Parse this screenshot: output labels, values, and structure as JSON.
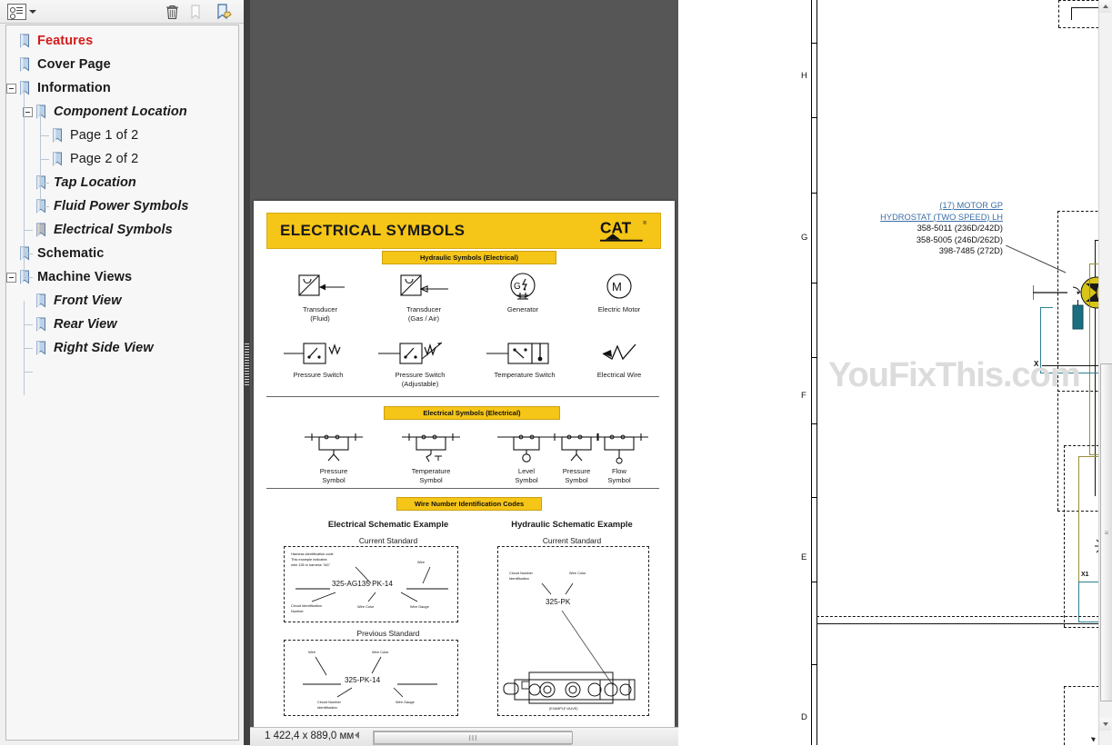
{
  "bookmark_panel": {
    "toolbar": {
      "options_icon": "bookmark-options-icon",
      "delete_icon": "trash-icon",
      "new_icon": "new-bookmark-icon",
      "edit_icon": "edit-bookmark-icon"
    },
    "items": [
      {
        "label": "Features",
        "level": 0,
        "style": "highlight",
        "expander": "none"
      },
      {
        "label": "Cover Page",
        "level": 0,
        "style": "bold",
        "expander": "none"
      },
      {
        "label": "Information",
        "level": 0,
        "style": "bold",
        "expander": "minus"
      },
      {
        "label": "Component Location",
        "level": 1,
        "style": "bold-italic",
        "expander": "minus"
      },
      {
        "label": "Page 1 of 2",
        "level": 2,
        "style": "normal",
        "expander": "none"
      },
      {
        "label": "Page 2 of 2",
        "level": 2,
        "style": "normal",
        "expander": "none"
      },
      {
        "label": "Tap Location",
        "level": 1,
        "style": "bold-italic",
        "expander": "none"
      },
      {
        "label": "Fluid Power Symbols",
        "level": 1,
        "style": "bold-italic",
        "expander": "none"
      },
      {
        "label": "Electrical Symbols",
        "level": 1,
        "style": "bold-italic",
        "expander": "none"
      },
      {
        "label": "Schematic",
        "level": 0,
        "style": "bold",
        "expander": "none"
      },
      {
        "label": "Machine Views",
        "level": 0,
        "style": "bold",
        "expander": "minus"
      },
      {
        "label": "Front View",
        "level": 1,
        "style": "normal",
        "expander": "none"
      },
      {
        "label": "Rear View",
        "level": 1,
        "style": "normal",
        "expander": "none"
      },
      {
        "label": "Right Side View",
        "level": 1,
        "style": "normal",
        "expander": "none"
      }
    ]
  },
  "document_page": {
    "title": "ELECTRICAL SYMBOLS",
    "brand": "CAT",
    "brand_tm": "®",
    "sections": [
      {
        "band": "Hydraulic Symbols (Electrical)"
      },
      {
        "band": "Electrical Symbols (Electrical)"
      },
      {
        "band": "Wire Number Identification Codes"
      }
    ],
    "hydraulic_symbols_row1": [
      {
        "name": "transducer-fluid-symbol",
        "caption_line1": "Transducer",
        "caption_line2": "(Fluid)"
      },
      {
        "name": "transducer-gas-air-symbol",
        "caption_line1": "Transducer",
        "caption_line2": "(Gas / Air)"
      },
      {
        "name": "generator-symbol",
        "caption_line1": "Generator",
        "caption_line2": ""
      },
      {
        "name": "electric-motor-symbol",
        "caption_line1": "Electric Motor",
        "caption_line2": ""
      }
    ],
    "hydraulic_symbols_row2": [
      {
        "name": "pressure-switch-symbol",
        "caption_line1": "Pressure Switch",
        "caption_line2": ""
      },
      {
        "name": "pressure-switch-adjustable-symbol",
        "caption_line1": "Pressure Switch",
        "caption_line2": "(Adjustable)"
      },
      {
        "name": "temperature-switch-symbol",
        "caption_line1": "Temperature Switch",
        "caption_line2": ""
      },
      {
        "name": "electrical-wire-symbol",
        "caption_line1": "Electrical Wire",
        "caption_line2": ""
      }
    ],
    "electrical_symbols_row": [
      {
        "name": "pressure-sender-symbol",
        "caption_line1": "Pressure",
        "caption_line2": "Symbol"
      },
      {
        "name": "temperature-sender-symbol",
        "caption_line1": "Temperature",
        "caption_line2": "Symbol"
      },
      {
        "name": "level-sender-symbol",
        "caption_line1": "Level",
        "caption_line2": "Symbol"
      },
      {
        "name": "flow-sender-symbol",
        "caption_line1": "Flow",
        "caption_line2": "Symbol"
      }
    ],
    "electrical_example": {
      "heading": "Electrical Schematic Example",
      "current_label": "Current Standard",
      "previous_label": "Previous Standard",
      "current_code": "325-AG135 PK-14",
      "previous_code": "325-PK-14",
      "current_notes": {
        "harness_l1": "Harness identification code",
        "harness_l2": "This example indicates",
        "harness_l3": "wire 135 in harness \"AG\"",
        "wire": "Wire",
        "circuit_l1": "Circuit Identification",
        "circuit_l2": "Number",
        "wire_color": "Wire Color",
        "wire_gauge": "Wire Gauge"
      },
      "previous_notes": {
        "wire": "Wire",
        "wire_color": "Wire Color",
        "circuit_l1": "Circuit Number",
        "circuit_l2": "Identification",
        "wire_gauge": "Wire Gauge"
      }
    },
    "hydraulic_example": {
      "heading": "Hydraulic Schematic Example",
      "current_label": "Current Standard",
      "code": "325-PK",
      "notes": {
        "circuit_l1": "Circuit Number",
        "circuit_l2": "Identification",
        "wire_color": "Wire Color",
        "valve_caption": "(EXAMPLE VALVE)"
      }
    }
  },
  "status_bar": {
    "dimensions": "1 422,4 x 889,0 мм",
    "hscroll_grip": "III"
  },
  "schematic_pane": {
    "row_labels": [
      "H",
      "G",
      "F",
      "E",
      "D"
    ],
    "callout": {
      "link_line1": "(17) MOTOR GP",
      "link_line2": "HYDROSTAT (TWO SPEED) LH",
      "part_numbers": [
        "358-5011 (236D/242D)",
        "358-5005 (246D/262D)",
        "398-7485 (272D)"
      ]
    },
    "terminal_labels": [
      "X",
      "X1"
    ],
    "vscroll_grip": "≡"
  },
  "watermark": {
    "text": "YouFixThis.com"
  },
  "colors": {
    "cat_yellow": "#f5c518",
    "highlight_red": "#d21b1b",
    "link_blue": "#3a6ea5",
    "viewer_gray": "#565656",
    "olive": "#9a8f3a",
    "teal": "#2d7f93"
  }
}
